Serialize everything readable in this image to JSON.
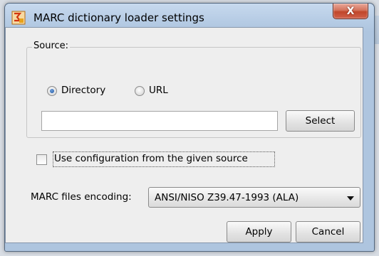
{
  "window": {
    "title": "MARC dictionary loader settings",
    "close_symbol": "X",
    "app_icon": "marc-loader-app-icon"
  },
  "source": {
    "legend": "Source:",
    "options": [
      {
        "label": "Directory",
        "selected": true
      },
      {
        "label": "URL",
        "selected": false
      }
    ],
    "path_value": "",
    "select_label": "Select"
  },
  "use_config": {
    "label": "Use configuration from the given source",
    "checked": false
  },
  "encoding": {
    "label": "MARC files encoding:",
    "selected": "ANSI/NISO Z39.47-1993 (ALA)"
  },
  "actions": {
    "apply_label": "Apply",
    "cancel_label": "Cancel"
  },
  "colors": {
    "title_bar": "#b9cde6",
    "close_button": "#c8553d",
    "radio_selected": "#2a62b0",
    "dialog_background": "#eeeeee"
  }
}
